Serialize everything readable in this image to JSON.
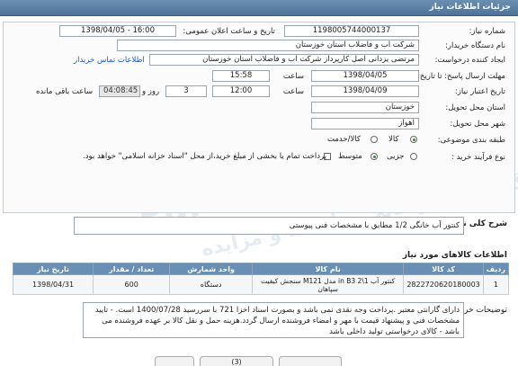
{
  "header": {
    "title": "جزئیات اطلاعات نیاز"
  },
  "fields": {
    "need_number_label": "شماره نیاز:",
    "need_number": "1198005744000137",
    "announce_label": "تاریخ و ساعت اعلان عمومی:",
    "announce_value": "1398/04/05 - 16:00",
    "buyer_label": "نام دستگاه خریدار:",
    "buyer_value": "شرکت آب و فاضلاب استان خوزستان",
    "creator_label": "ایجاد کننده درخواست:",
    "creator_value": "مرتضی یزدانی اصل کارپرداز شرکت آب و فاضلاب استان خوزستان",
    "contact_link": "اطلاعات تماس خریدار",
    "send_deadline_label": "مهلت ارسال پاسخ: تا تاریخ:",
    "send_date": "1398/04/05",
    "time_label": "ساعت",
    "send_time": "15:58",
    "valid_label": "تاریخ اعتبار نیاز:",
    "valid_date": "1398/04/09",
    "valid_time": "12:00",
    "days": "3",
    "days_label": "روز و",
    "countdown": "04:08:45",
    "remaining_label": "ساعت باقی مانده",
    "province_label": "استان محل تحویل:",
    "province_value": "خوزستان",
    "city_label": "شهر محل تحویل:",
    "city_value": "اهواز",
    "category_label": "طبقه بندی موضوعی:",
    "cat_goods": "کالا",
    "cat_goods_service": "کالا/خدمت",
    "process_label": "نوع فرآیند خرید :",
    "proc_small": "جزیی",
    "proc_medium": "متوسط",
    "payment_note": "پرداخت تمام یا بخشی از مبلغ خرید،از محل \"اسناد خزانه اسلامی\" خواهد بود."
  },
  "summary": {
    "label": "شرح کلی نیاز:",
    "value": "کنتور آب خانگی 1/2 مطابق با مشخصات فنی پیوستی"
  },
  "items_title": "اطلاعات کالاهای مورد نیاز",
  "table": {
    "headers": [
      "ردیف",
      "کد کالا",
      "نام کالا",
      "واحد شمارش",
      "تعداد / مقدار",
      "تاریخ نیاز"
    ],
    "rows": [
      [
        "1",
        "2822720620180003",
        "کنتور آب 1\\2 in B3 مدل M121 سنجش کیفیت سپاهان",
        "دستگاه",
        "600",
        "1398/04/31"
      ]
    ]
  },
  "notes": {
    "label": "توضیحات خریدار:",
    "value": "دارای گارانتی معتبر .پرداخت وجه نقدی نمی باشد و بصورت اسناد اخزا 721 با سررسید 1400/07/28 است. - تایید مشخصات فنی و پیشنهاد قیمت با مهر و امضاء فروشنده ارسال گردد.هزینه حمل و نقل کالا بر عهده فروشنده می باشد - کالای درخواستی تولید داخلی باشد"
  },
  "footer": {
    "btn_right": "",
    "btn_mid": "(3)",
    "btn_left": ""
  },
  "watermark": {
    "line1": "ParsNamadData",
    "line2": "پایگاه اطلاع رسانی مناقصه و مزایده"
  }
}
